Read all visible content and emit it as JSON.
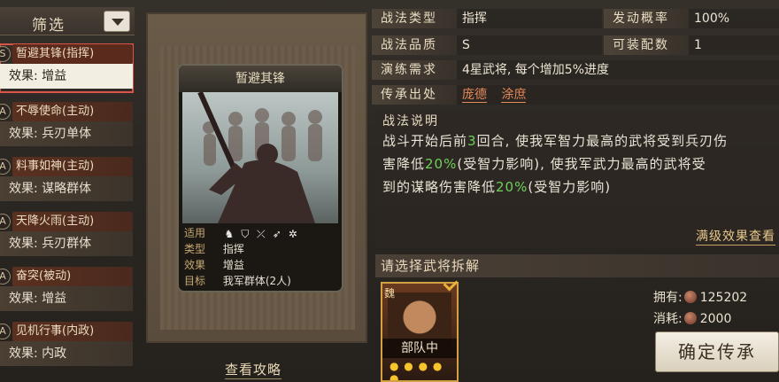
{
  "filter": {
    "label": "筛选"
  },
  "tactics": [
    {
      "badge": "S",
      "name": "暂避其锋(指挥)",
      "effect": "效果: 增益",
      "selected": true
    },
    {
      "badge": "A",
      "name": "不辱使命(主动)",
      "effect": "效果: 兵刃单体"
    },
    {
      "badge": "A",
      "name": "料事如神(主动)",
      "effect": "效果: 谋略群体"
    },
    {
      "badge": "A",
      "name": "天降火雨(主动)",
      "effect": "效果: 兵刃群体"
    },
    {
      "badge": "A",
      "name": "奋突(被动)",
      "effect": "效果: 增益"
    },
    {
      "badge": "A",
      "name": "见机行事(内政)",
      "effect": "效果: 内政"
    }
  ],
  "card": {
    "title": "暂避其锋",
    "applicable_key": "适用",
    "type_key": "类型",
    "type_val": "指挥",
    "effect_key": "效果",
    "effect_val": "增益",
    "target_key": "目标",
    "target_val": "我军群体(2人)",
    "applicable_icons": [
      "cavalry-icon",
      "shield-icon",
      "bow-icon",
      "spear-icon",
      "siege-icon"
    ]
  },
  "guide_link": "查看攻略",
  "details": {
    "tactic_type_label": "战法类型",
    "tactic_type_val": "指挥",
    "trigger_rate_label": "发动概率",
    "trigger_rate_val": "100%",
    "quality_label": "战法品质",
    "quality_val": "S",
    "equip_count_label": "可装配数",
    "equip_count_val": "1",
    "training_label": "演练需求",
    "training_val": "4星武将, 每个增加5%进度",
    "inherit_label": "传承出处",
    "inherit_sources": [
      "庞德",
      "涂庶"
    ]
  },
  "description": {
    "title": "战法说明",
    "line1_a": "战斗开始后前",
    "line1_hl": "3",
    "line1_b": "回合, 使我军智力最高的武将受到兵刃伤",
    "line2_a": "害降低",
    "line2_hl": "20%",
    "line2_b": "(受智力影响), 使我军武力最高的武将受",
    "line3_a": "到的谋略伤害降低",
    "line3_hl": "20%",
    "line3_b": "(受智力影响)"
  },
  "max_effect_link": "满级效果查看",
  "choose_general_label": "请选择武将拆解",
  "general": {
    "faction": "魏",
    "troop": "部队中"
  },
  "resources": {
    "own_label": "拥有:",
    "own_val": "125202",
    "cost_label": "消耗:",
    "cost_val": "2000"
  },
  "confirm_button": "确定传承",
  "colors": {
    "highlight": "#6fcf5b",
    "link": "#e88a5a",
    "selected_outline": "#d9554a"
  }
}
